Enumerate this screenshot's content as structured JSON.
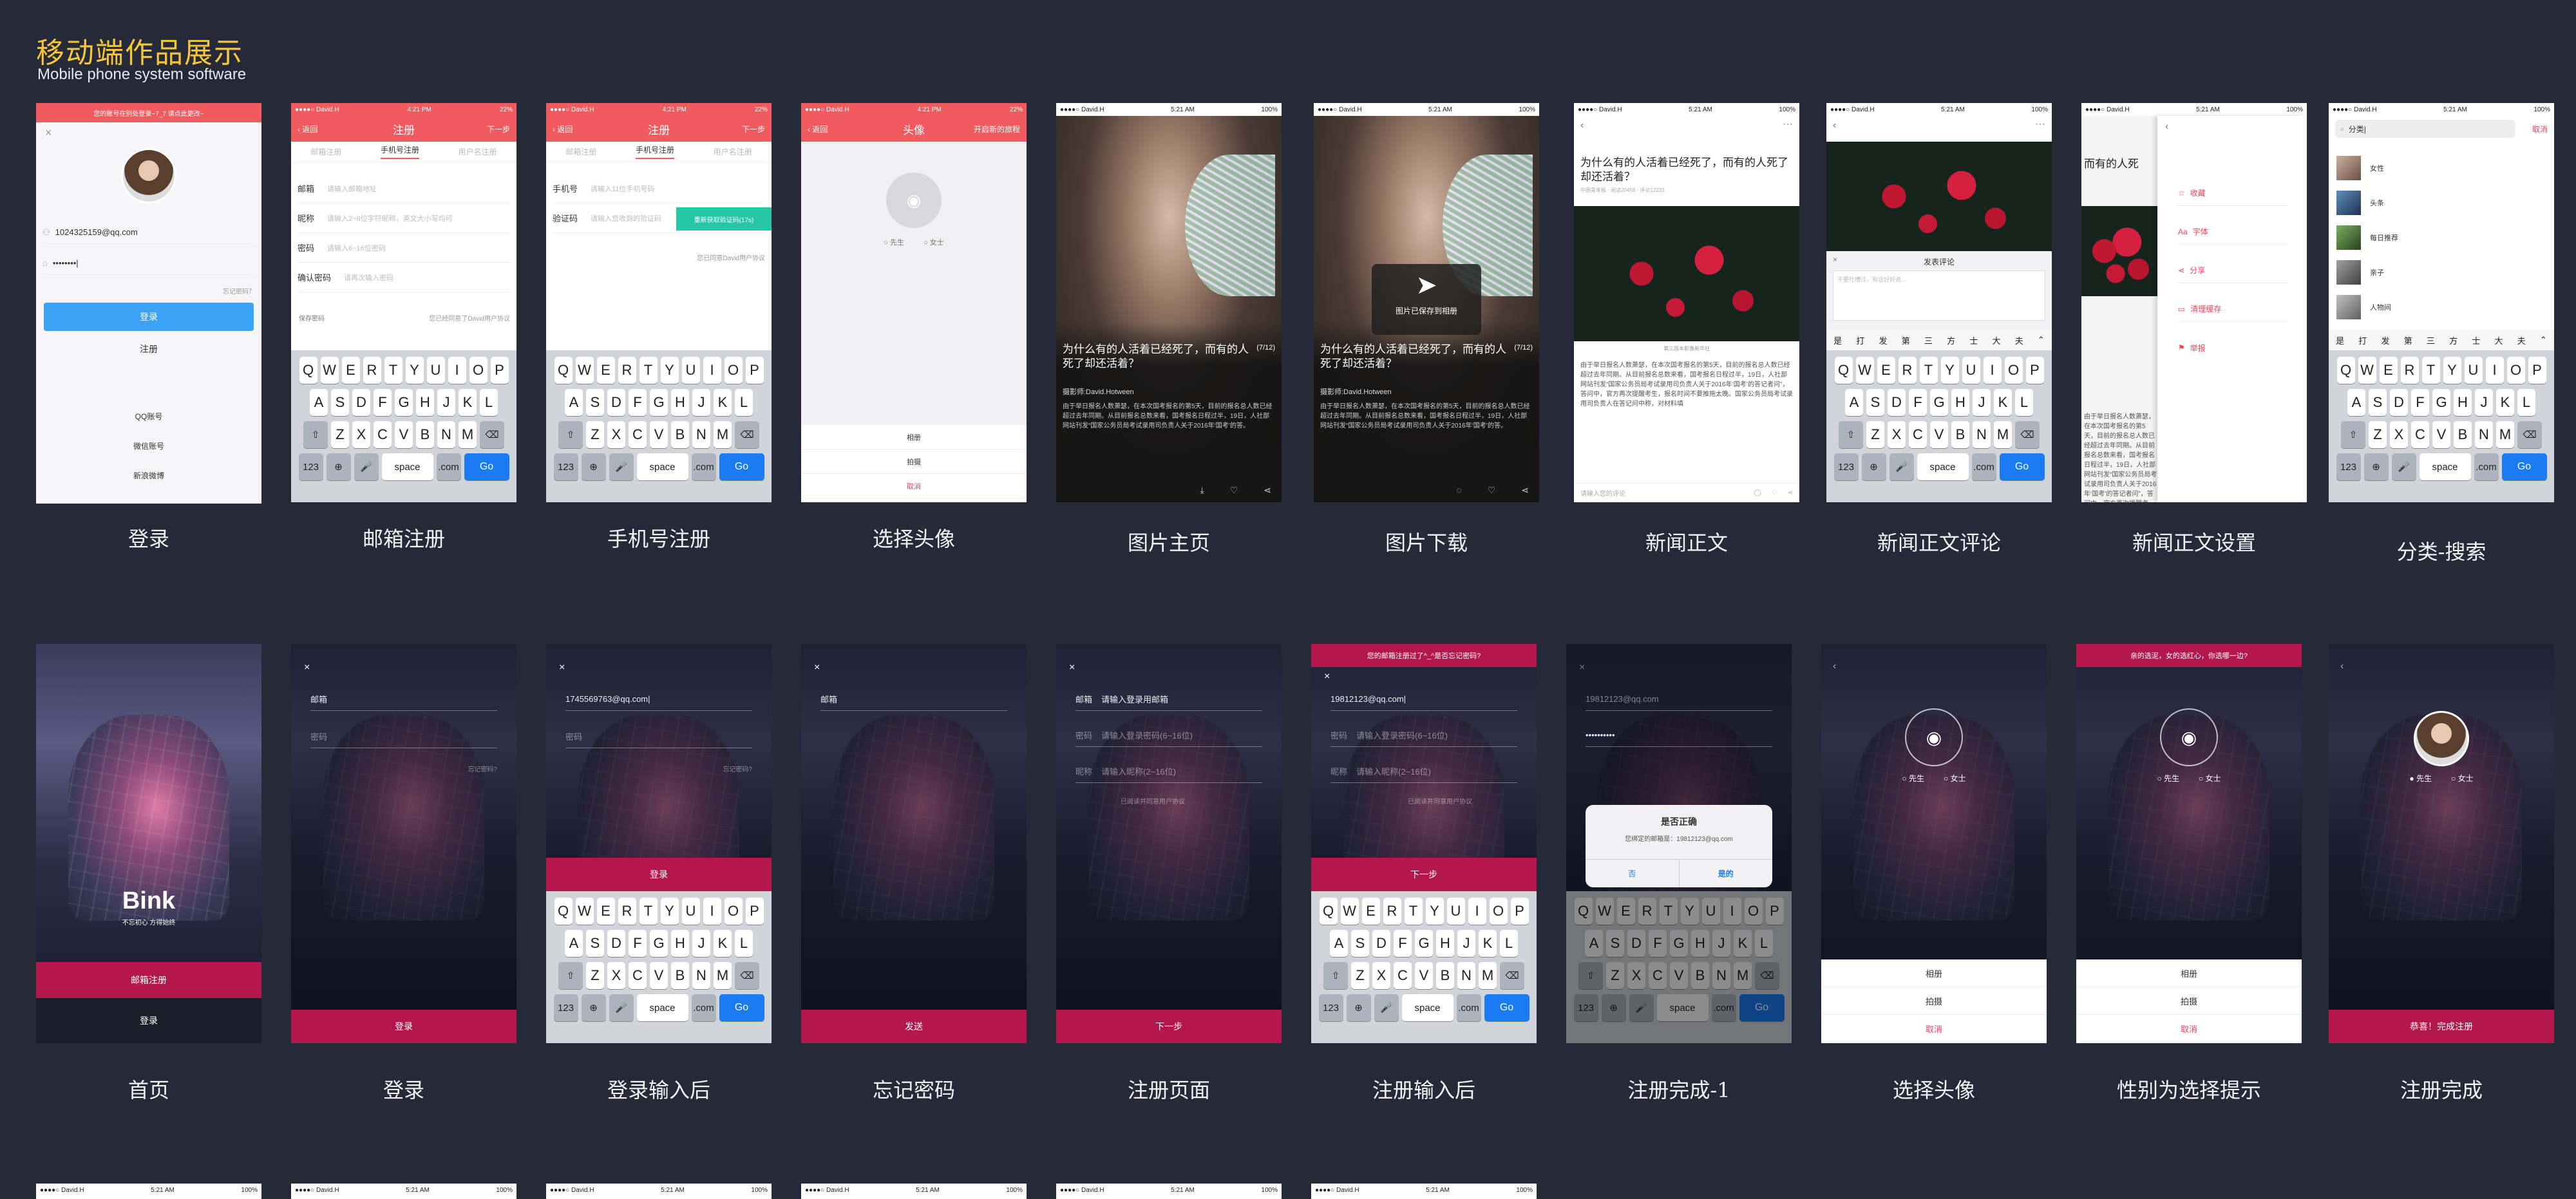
{
  "header": {
    "title": "移动端作品展示",
    "subtitle": "Mobile phone system software"
  },
  "status": {
    "carrier": "●●●●○ David.H",
    "time": "4:21 PM",
    "time2": "5:21 AM",
    "battery": "22%",
    "battery2": "100%"
  },
  "keyboard": {
    "row1": [
      "Q",
      "W",
      "E",
      "R",
      "T",
      "Y",
      "U",
      "I",
      "O",
      "P"
    ],
    "row2": [
      "A",
      "S",
      "D",
      "F",
      "G",
      "H",
      "J",
      "K",
      "L"
    ],
    "row3": [
      "Z",
      "X",
      "C",
      "V",
      "B",
      "N",
      "M"
    ],
    "num": "123",
    "space": "space",
    "com": ".com",
    "go": "Go",
    "shift": "⇧",
    "del": "⌫",
    "globe": "⊕",
    "mic": "🎤"
  },
  "row1": {
    "login": {
      "caption": "登录",
      "toast": "您的账号在别处登录~7_7 请点此更改~",
      "email": "1024325159@qq.com",
      "password": "••••••••|",
      "forgot": "忘记密码？",
      "login_btn": "登录",
      "register_btn": "注册",
      "qq": "QQ账号",
      "wechat": "微信账号",
      "weibo": "新浪微博"
    },
    "email_reg": {
      "caption": "邮箱注册",
      "nav_back": "‹ 返回",
      "nav_title": "注册",
      "nav_next": "下一步",
      "tabs": [
        "邮箱注册",
        "手机号注册",
        "用户名注册"
      ],
      "labels": [
        "邮箱",
        "昵称",
        "密码",
        "确认密码"
      ],
      "placeholders": [
        "请输入邮箱地址",
        "请输入2~8位字符昵称，英文大小写均可",
        "请输入6~16位密码",
        "请再次输入密码"
      ],
      "save_pwd": "保存密码",
      "agree": "您已经同意了David用户协议"
    },
    "phone_reg": {
      "caption": "手机号注册",
      "labels": [
        "手机号",
        "验证码"
      ],
      "placeholders": [
        "请输入11位手机号码",
        "请输入您收到的验证码"
      ],
      "resend": "重新获取验证码(17s)",
      "agree": "您已同意David用户协议"
    },
    "avatar": {
      "caption": "选择头像",
      "nav_back": "‹ 返回",
      "nav_title": "头像",
      "nav_next": "开启新的旅程",
      "male": "先生",
      "female": "女士",
      "album": "相册",
      "camera": "拍摄",
      "cancel": "取消"
    },
    "photo_home": {
      "caption": "图片主页",
      "headline": "为什么有的人活着已经死了，而有的人死了却还活着？",
      "count": "(7/12)",
      "author": "摄影师:David.Hotween",
      "body": "由于举日报名人数萧瑟，在本次国考报名的第5天，目前的报名总人数已经超过去年同期。从目前报名总数来看，国考报名日程过半，19日，人社部网站刊发“国家公务员局考试录用司负责人关于2016年‘国考’的答。"
    },
    "photo_dl": {
      "caption": "图片下载",
      "saved": "图片已保存到相册"
    },
    "news": {
      "caption": "新闻正文",
      "headline": "为什么有的人活着已经死了，而有的人死了却还活着？",
      "meta": "中国青年报 · 阅读20458 · 评论12233",
      "img_cap": "第三版本影像新华社",
      "body": "由于举日报名人数萧瑟，在本次国考报名的第5天，目前的报名总人数已经超过去年同期。从目前报名总数来看，国考报名日程过半，19日，人社部网站刊发“国家公务员局考试录用司负责人关于2016年‘国考’的答记者问”，答问中，官方再次提醒考生，报名时间不要推拖太晚。国家公务员局考试录用司负责人在答记问中称，对材料填",
      "input": "请输入您的评论"
    },
    "comment": {
      "caption": "新闻正文评论",
      "title": "发表评论",
      "placeholder": "不要吐槽过，有话好好说...",
      "quick": [
        "是",
        "打",
        "发",
        "第",
        "三",
        "方",
        "士",
        "大",
        "夫"
      ]
    },
    "settings": {
      "caption": "新闻正文设置",
      "headline": "而有的人死",
      "items": [
        "收藏",
        "字体",
        "分享",
        "清理缓存",
        "举报"
      ],
      "font_prefix": "Aa"
    },
    "search": {
      "caption": "分类-搜索",
      "input": "分类|",
      "cancel": "取消",
      "items": [
        "女性",
        "头条",
        "每日推荐",
        "亲子",
        "人物间"
      ]
    }
  },
  "row2": {
    "home": {
      "caption": "首页",
      "brand": "Bink",
      "slogan": "不忘初心 方得始终",
      "reg_btn": "邮箱注册",
      "login_btn": "登录"
    },
    "login": {
      "caption": "登录",
      "email": "邮箱",
      "password": "密码",
      "forgot": "忘记密码?",
      "btn": "登录"
    },
    "login_typed": {
      "caption": "登录输入后",
      "email": "1745569763@qq.com|",
      "password": "密码",
      "forgot": "忘记密码?",
      "btn": "登录"
    },
    "forgot": {
      "caption": "忘记密码",
      "email": "邮箱",
      "btn": "发送"
    },
    "register": {
      "caption": "注册页面",
      "email_label": "邮箱",
      "email_ph": "请输入登录用邮箱",
      "pwd_label": "密码",
      "pwd_ph": "请输入登录密码(6~16位)",
      "nick_label": "昵称",
      "nick_ph": "请输入昵称(2~16位)",
      "agree": "已阅读并同意用户协议",
      "btn": "下一步"
    },
    "register_typed": {
      "caption": "注册输入后",
      "toast": "您的邮箱注册过了^_^是否忘记密码?",
      "email": "19812123@qq.com|",
      "btn": "下一步"
    },
    "reg_done1": {
      "caption": "注册完成-1",
      "email": "19812123@qq.com",
      "password": "••••••••••",
      "dlg_title": "是否正确",
      "dlg_msg": "您绑定的邮箱是：19812123@qq.com",
      "no": "否",
      "yes": "是的"
    },
    "pick_avatar": {
      "caption": "选择头像",
      "male": "先生",
      "female": "女士",
      "album": "相册",
      "camera": "拍摄",
      "cancel": "取消"
    },
    "gender": {
      "caption": "性别为选择提示",
      "toast": "亲的选泥，女的选红心，你选哪一边?",
      "album": "相册",
      "camera": "拍摄",
      "cancel": "取消"
    },
    "done": {
      "caption": "注册完成",
      "male": "先生",
      "female": "女士",
      "btn": "恭喜！完成注册"
    }
  }
}
